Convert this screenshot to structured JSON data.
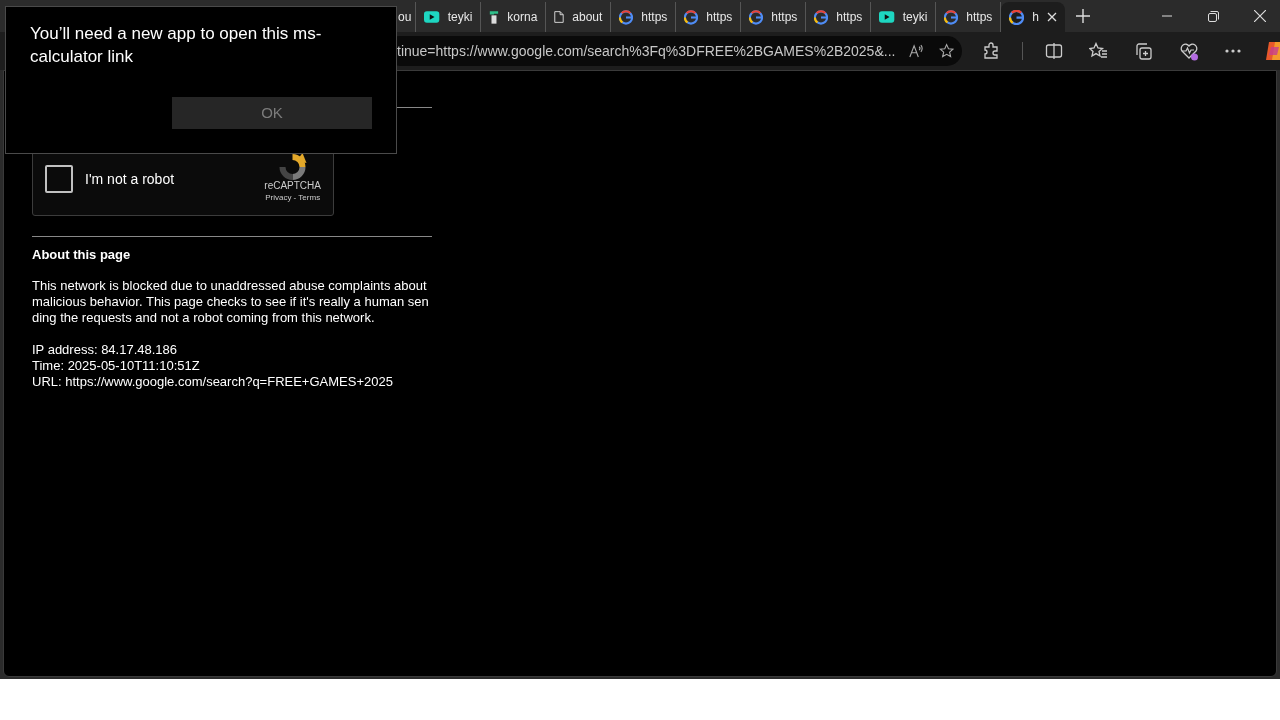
{
  "tabs": [
    {
      "label": "ou",
      "kind": "partial",
      "selected": false
    },
    {
      "label": "teyki",
      "kind": "video",
      "selected": false
    },
    {
      "label": "korna",
      "kind": "plant",
      "selected": false
    },
    {
      "label": "about",
      "kind": "document",
      "selected": false
    },
    {
      "label": "https",
      "kind": "google",
      "selected": false
    },
    {
      "label": "https",
      "kind": "google",
      "selected": false
    },
    {
      "label": "https",
      "kind": "google",
      "selected": false
    },
    {
      "label": "https",
      "kind": "google",
      "selected": false
    },
    {
      "label": "teyki",
      "kind": "video",
      "selected": false
    },
    {
      "label": "https",
      "kind": "google",
      "selected": false
    },
    {
      "label": "h",
      "kind": "google",
      "selected": true
    }
  ],
  "address_bar": {
    "url": "tinue=https://www.google.com/search%3Fq%3DFREE%2BGAMES%2B2025&..."
  },
  "captcha": {
    "label": "I'm not a robot",
    "checked": false,
    "brand": "reCAPTCHA",
    "links": "Privacy - Terms"
  },
  "about": {
    "heading": "About this page",
    "paragraph": "This network is blocked due to unaddressed abuse complaints about malicious behavior. This page checks to see if it's really a human sending the requests and not a robot coming from this network.",
    "ip": "IP address: 84.17.48.186",
    "time": "Time: 2025-05-10T11:10:51Z",
    "url": "URL: https://www.google.com/search?q=FREE+GAMES+2025"
  },
  "dialog": {
    "message": "You’ll need a new app to open this ms-calculator link",
    "button": "OK"
  }
}
